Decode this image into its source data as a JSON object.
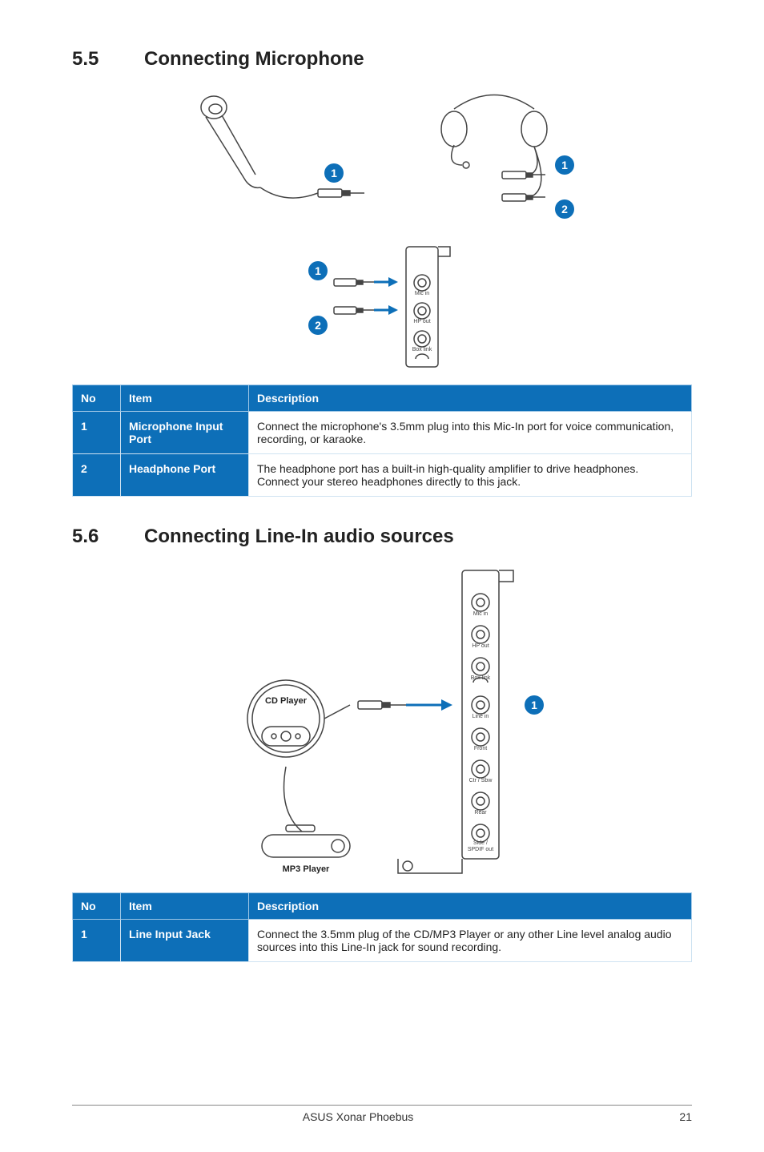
{
  "section55": {
    "num": "5.5",
    "title": "Connecting Microphone",
    "table": {
      "headers": {
        "no": "No",
        "item": "Item",
        "desc": "Description"
      },
      "rows": [
        {
          "no": "1",
          "item": "Microphone Input Port",
          "desc": "Connect the microphone's 3.5mm plug into this Mic-In port for voice communication, recording, or karaoke."
        },
        {
          "no": "2",
          "item": "Headphone Port",
          "desc": "The headphone port has a built-in high-quality amplifier to drive headphones. Connect your stereo headphones directly to this jack."
        }
      ]
    },
    "diagram_labels": {
      "mic_in": "Mic in",
      "hp_out": "HP out",
      "box_link": "Box link"
    }
  },
  "section56": {
    "num": "5.6",
    "title": "Connecting Line-In audio sources",
    "table": {
      "headers": {
        "no": "No",
        "item": "Item",
        "desc": "Description"
      },
      "rows": [
        {
          "no": "1",
          "item": "Line Input Jack",
          "desc": "Connect the 3.5mm plug of the CD/MP3 Player or any other Line level analog audio sources into this Line-In jack for sound recording."
        }
      ]
    },
    "diagram_labels": {
      "cd_player": "CD Player",
      "mp3_player": "MP3 Player",
      "mic_in": "Mic in",
      "hp_out": "HP out",
      "box_link": "Box link",
      "line_in": "Line in",
      "front": "Front",
      "ctr_sbw": "Ctr / Sbw",
      "rear": "Rear",
      "side_spdif": "Side /\nSPDIF out"
    }
  },
  "footer": {
    "product": "ASUS Xonar Phoebus",
    "page": "21"
  }
}
